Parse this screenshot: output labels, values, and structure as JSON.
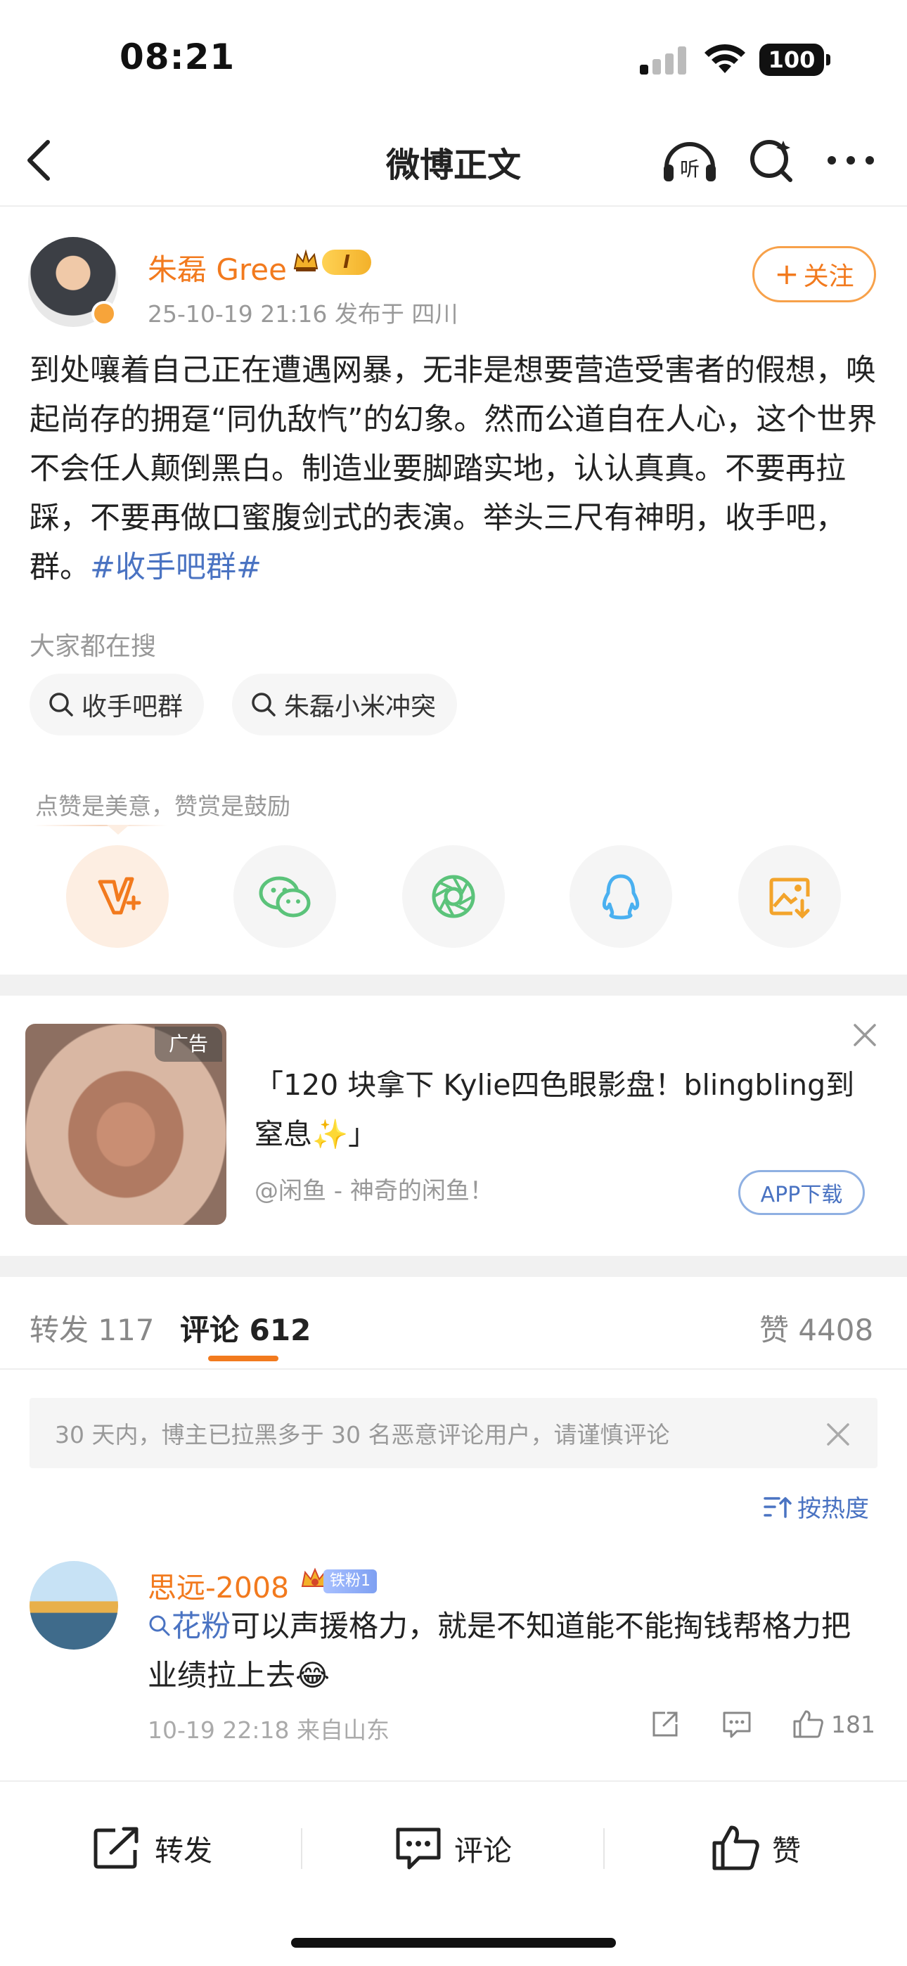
{
  "status_bar": {
    "time": "08:21",
    "battery": "100"
  },
  "nav": {
    "title": "微博正文",
    "listen_label": "听"
  },
  "post": {
    "author": "朱磊 Gree",
    "vip_level": "I",
    "meta": "25-10-19 21:16   发布于 四川",
    "follow_label": "关注",
    "text": "到处嚷着自己正在遭遇网暴，无非是想要营造受害者的假想，唤起尚存的拥趸“同仇敌忾”的幻象。然而公道自在人心，这个世界不会任人颠倒黑白。制造业要脚踏实地，认认真真。不要再拉踩，不要再做口蜜腹剑式的表演。举头三尺有神明，收手吧，群。",
    "hashtag": "#收手吧群#"
  },
  "search": {
    "label": "大家都在搜",
    "chips": [
      "收手吧群",
      "朱磊小米冲突"
    ]
  },
  "reward": {
    "label": "点赞是美意，赞赏是鼓励"
  },
  "share_icons": [
    "reward-v-icon",
    "wechat-icon",
    "moments-icon",
    "qq-icon",
    "save-image-icon"
  ],
  "ad": {
    "tag": "广告",
    "title": "「120 块拿下 Kylie四色眼影盘！blingbling到窒息✨」",
    "source": "@闲鱼 - 神奇的闲鱼！",
    "button": "APP下载"
  },
  "tabs": {
    "repost": "转发 117",
    "comment": "评论 612",
    "like": "赞 4408"
  },
  "notice": "30 天内，博主已拉黑多于 30 名恶意评论用户，请谨慎评论",
  "sort_label": "按热度",
  "comment": {
    "name": "思远-2008",
    "fan_badge": "铁粉1",
    "mention": "花粉",
    "text": "可以声援格力，就是不知道能不能掏钱帮格力把业绩拉上去😂",
    "meta": "10-19 22:18   来自山东",
    "likes": "181"
  },
  "toolbar": {
    "repost": "转发",
    "comment": "评论",
    "like": "赞"
  },
  "colors": {
    "accent": "#f27a1e",
    "link": "#4a73c2"
  }
}
